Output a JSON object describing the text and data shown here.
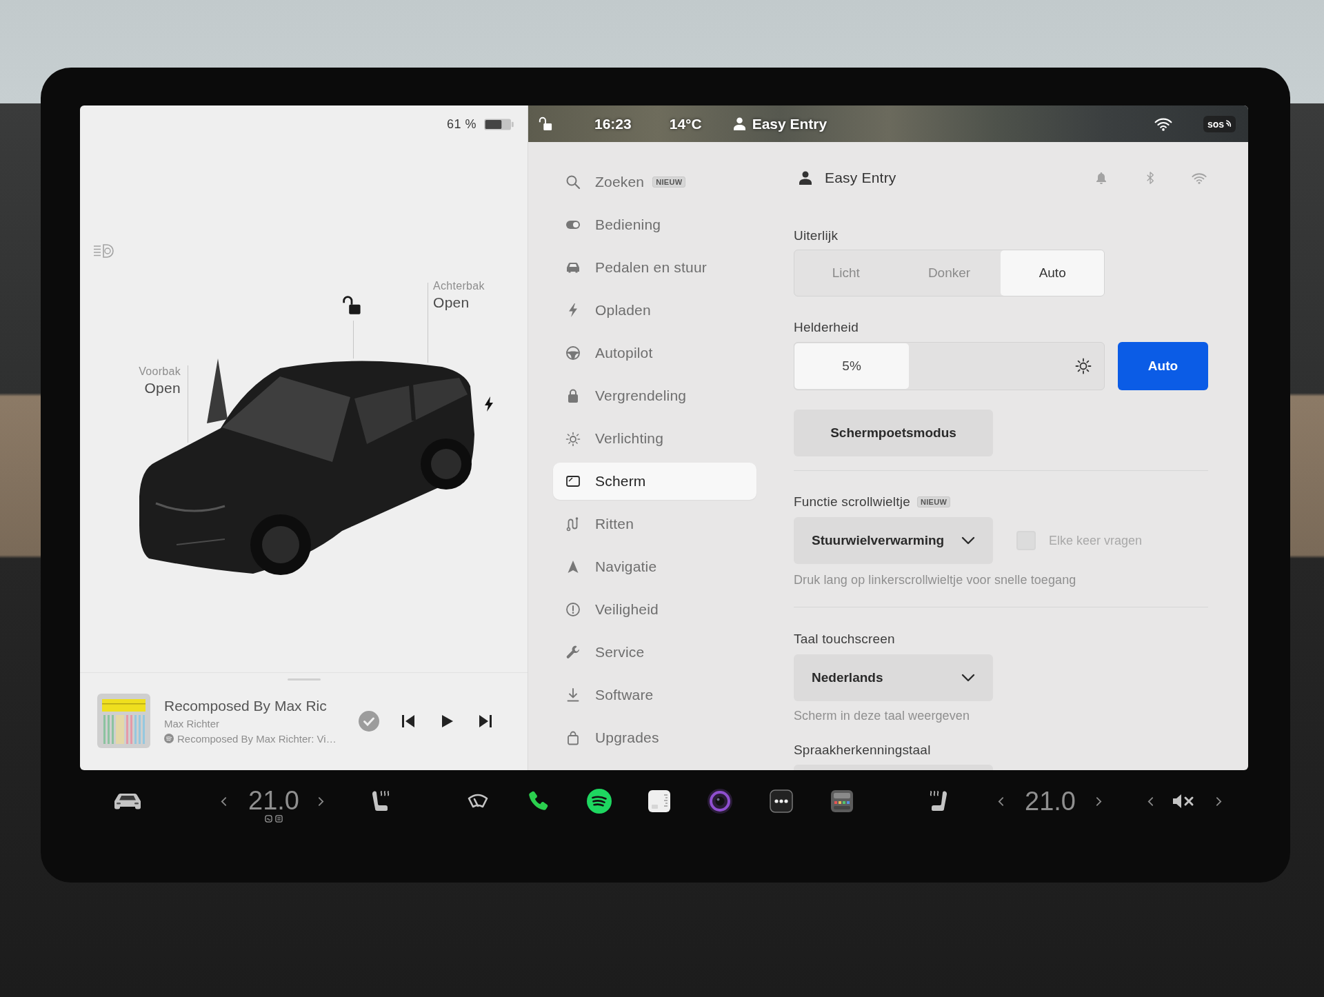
{
  "status_bar": {
    "locked": false,
    "time": "16:23",
    "temperature": "14°C",
    "profile": "Easy Entry",
    "sos": "sos"
  },
  "vehicle_panel": {
    "battery": "61 %",
    "locked": false,
    "callouts": [
      {
        "label": "Voorbak",
        "status": "Open"
      },
      {
        "label": "Achterbak",
        "status": "Open"
      }
    ]
  },
  "media_player": {
    "title": "Recomposed By Max Ric",
    "artist": "Max Richter",
    "source": "Recomposed By Max Richter: Vi…"
  },
  "menu": {
    "items": [
      {
        "label": "Zoeken",
        "badge": "NIEUW",
        "selected": false
      },
      {
        "label": "Bediening",
        "selected": false
      },
      {
        "label": "Pedalen en stuur",
        "selected": false
      },
      {
        "label": "Opladen",
        "selected": false
      },
      {
        "label": "Autopilot",
        "selected": false
      },
      {
        "label": "Vergrendeling",
        "selected": false
      },
      {
        "label": "Verlichting",
        "selected": false
      },
      {
        "label": "Scherm",
        "selected": true
      },
      {
        "label": "Ritten",
        "selected": false
      },
      {
        "label": "Navigatie",
        "selected": false
      },
      {
        "label": "Veiligheid",
        "selected": false
      },
      {
        "label": "Service",
        "selected": false
      },
      {
        "label": "Software",
        "selected": false
      },
      {
        "label": "Upgrades",
        "selected": false
      }
    ]
  },
  "display_settings": {
    "profile": "Easy Entry",
    "appearance": {
      "label": "Uiterlijk",
      "options": [
        {
          "label": "Licht",
          "selected": false
        },
        {
          "label": "Donker",
          "selected": false
        },
        {
          "label": "Auto",
          "selected": true
        }
      ]
    },
    "brightness": {
      "label": "Helderheid",
      "reading": "5%",
      "level": 0.37,
      "auto": {
        "label": "Auto",
        "on": true
      }
    },
    "clean_mode_button": "Schermpoetsmodus",
    "scroll_wheel": {
      "label": "Functie scrollwieltje",
      "badge": "NIEUW",
      "value": "Stuurwielverwarming",
      "ask_each_time": {
        "label": "Elke keer vragen",
        "checked": false,
        "disabled": true
      },
      "hint": "Druk lang op linkerscrollwieltje voor snelle toegang"
    },
    "touchscreen_language": {
      "label": "Taal touchscreen",
      "value": "Nederlands",
      "hint": "Scherm in deze taal weergeven"
    },
    "voice_language": {
      "label": "Spraakherkenningstaal"
    }
  },
  "dock": {
    "driver_temperature": "21.0",
    "passenger_temperature": "21.0"
  }
}
